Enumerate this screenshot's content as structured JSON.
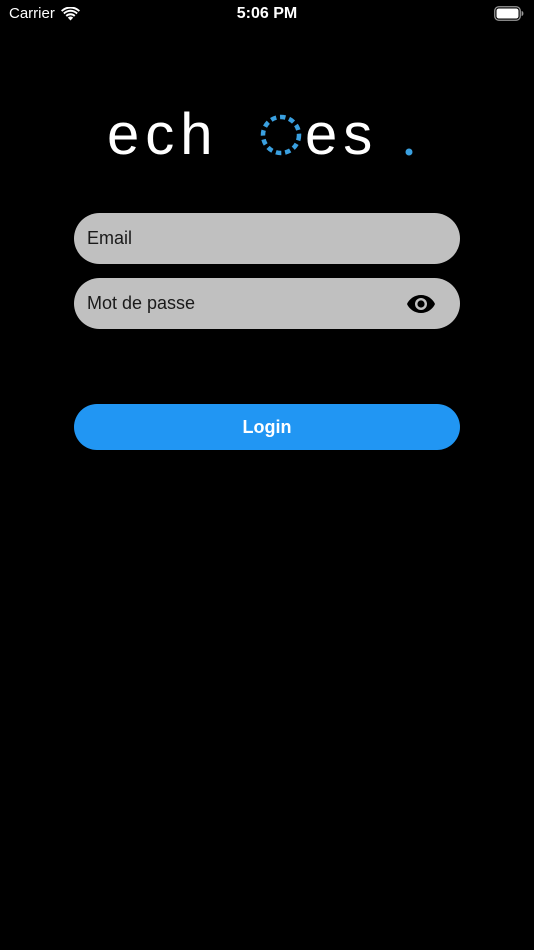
{
  "status_bar": {
    "carrier": "Carrier",
    "time": "5:06 PM",
    "wifi_icon": "wifi-icon",
    "battery_icon": "battery-icon"
  },
  "logo": {
    "text_before": "ech",
    "text_after": "es",
    "dot": ".",
    "text_color": "#ffffff",
    "accent_color": "#3aa0e0"
  },
  "email_field": {
    "placeholder": "Email",
    "value": ""
  },
  "password_field": {
    "placeholder": "Mot de passe",
    "value": "",
    "toggle_icon": "eye-icon"
  },
  "login_button": {
    "label": "Login",
    "color": "#2196f3"
  },
  "colors": {
    "background": "#000000",
    "field_background": "#c0c0c0"
  }
}
